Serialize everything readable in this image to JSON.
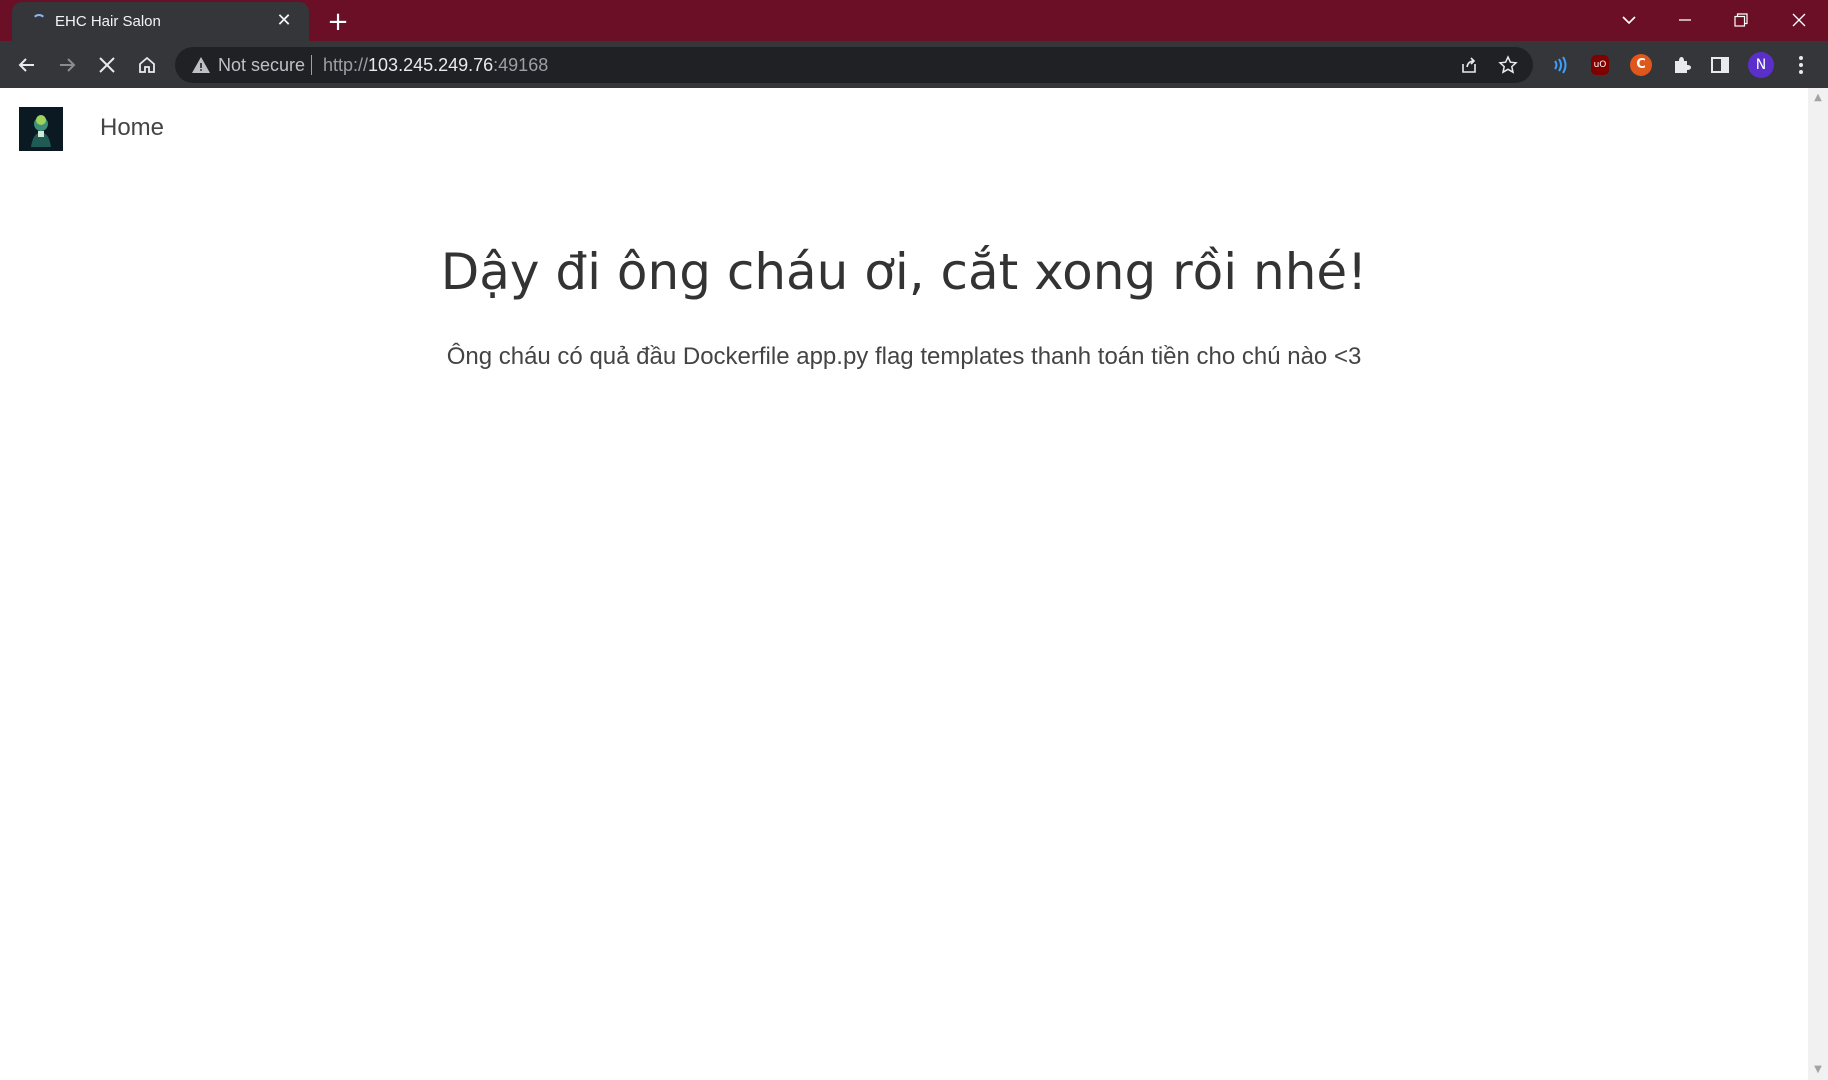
{
  "browser": {
    "tab_title": "EHC Hair Salon",
    "tab_close": "✕",
    "new_tab": "+",
    "security_label": "Not secure",
    "url_scheme": "http://",
    "url_host": "103.245.249.76",
    "url_port": ":49168",
    "profile_initial": "N",
    "ublock_label": "uO",
    "ext_c_label": "C"
  },
  "site": {
    "nav_home": "Home",
    "title": "Dậy đi ông cháu ơi, cắt xong rồi nhé!",
    "subtitle": "Ông cháu có quả đầu Dockerfile app.py flag templates thanh toán tiền cho chú nào <3"
  },
  "colors": {
    "titlebar": "#6b0f26",
    "tab_bg": "#35363a",
    "toolbar": "#35363a",
    "omnibox": "#202124"
  }
}
